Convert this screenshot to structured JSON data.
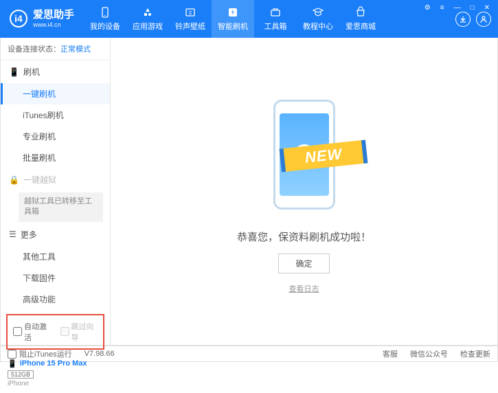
{
  "app": {
    "title": "爱思助手",
    "subtitle": "www.i4.cn"
  },
  "nav": {
    "items": [
      {
        "label": "我的设备"
      },
      {
        "label": "应用游戏"
      },
      {
        "label": "铃声壁纸"
      },
      {
        "label": "智能刷机"
      },
      {
        "label": "工具箱"
      },
      {
        "label": "教程中心"
      },
      {
        "label": "爱思商城"
      }
    ],
    "activeIndex": 3
  },
  "status": {
    "label": "设备连接状态：",
    "value": "正常模式"
  },
  "sidebar": {
    "flash": {
      "header": "刷机",
      "items": [
        "一键刷机",
        "iTunes刷机",
        "专业刷机",
        "批量刷机"
      ]
    },
    "jailbreak": {
      "header": "一键越狱",
      "note": "越狱工具已转移至工具箱"
    },
    "more": {
      "header": "更多",
      "items": [
        "其他工具",
        "下载固件",
        "高级功能"
      ]
    }
  },
  "checkboxes": {
    "autoActivate": "自动激活",
    "skipGuide": "跳过向导"
  },
  "device": {
    "name": "iPhone 15 Pro Max",
    "storage": "512GB",
    "type": "iPhone"
  },
  "main": {
    "ribbon": "NEW",
    "successMsg": "恭喜您，保资料刷机成功啦！",
    "okBtn": "确定",
    "viewLog": "查看日志"
  },
  "footer": {
    "blockItunes": "阻止iTunes运行",
    "version": "V7.98.66",
    "support": "客服",
    "wechat": "微信公众号",
    "checkUpdate": "检查更新"
  }
}
